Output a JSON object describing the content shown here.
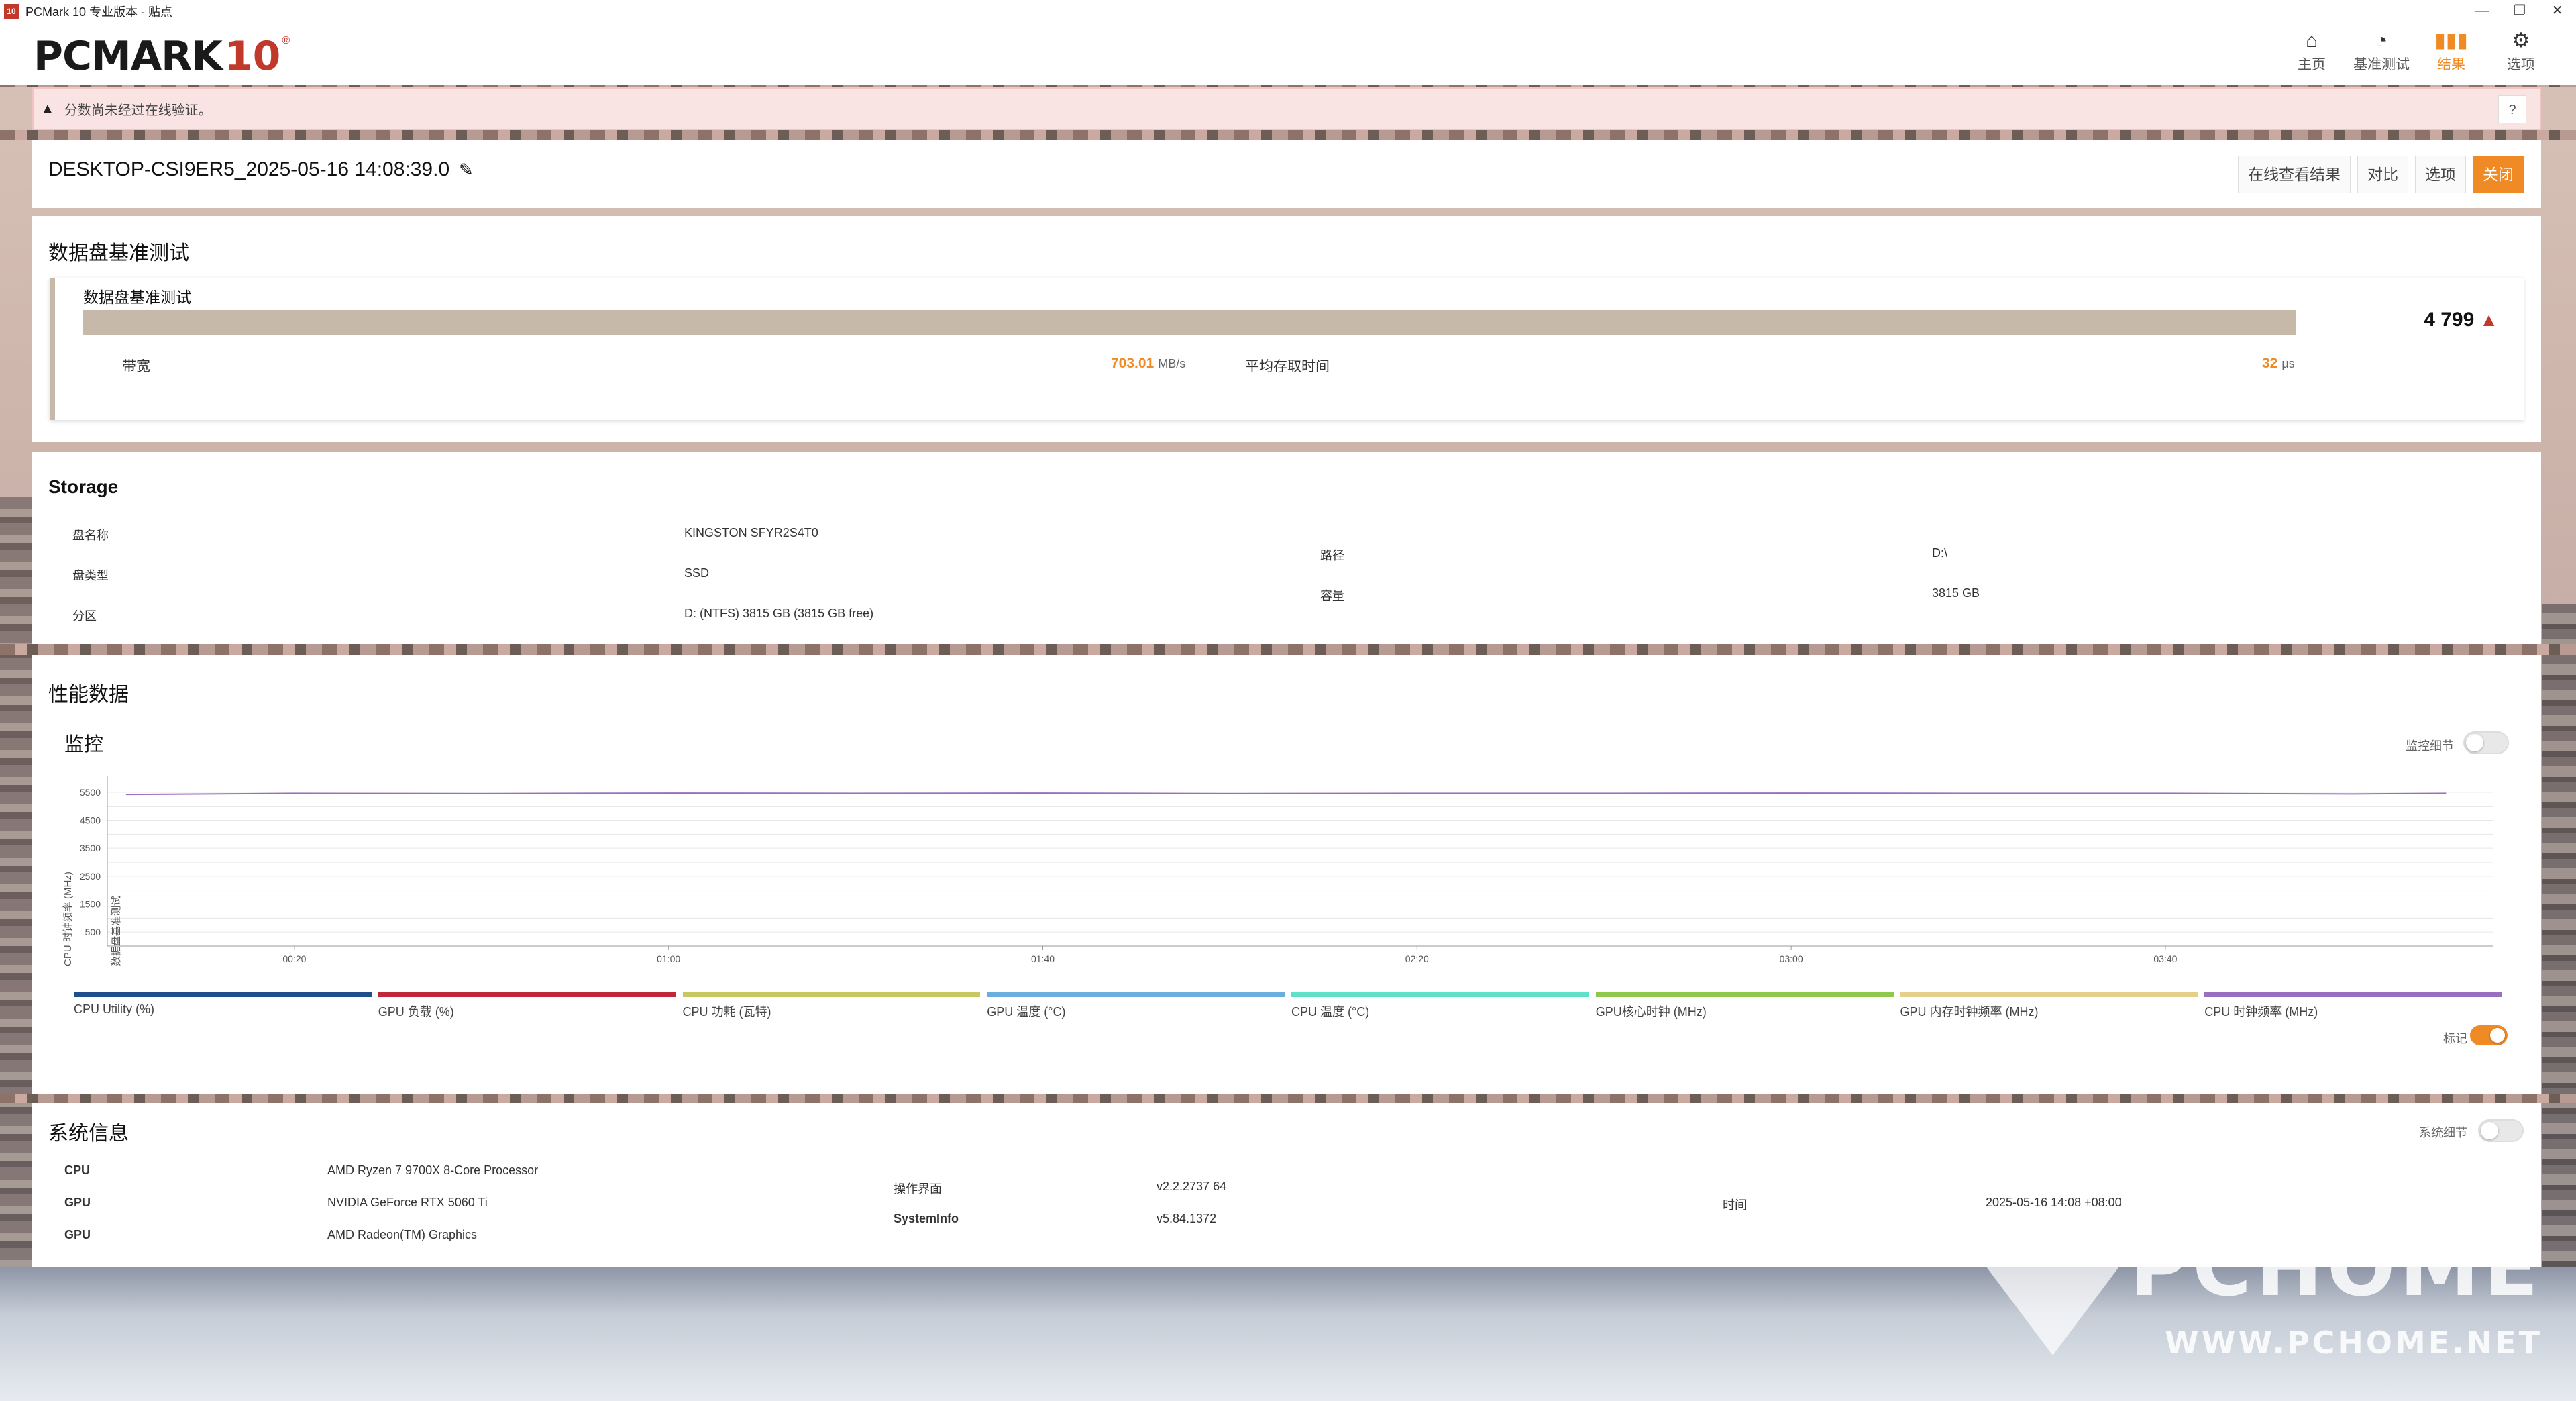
{
  "window": {
    "title": "PCMark 10 专业版本 - 贴点",
    "app_icon": "10"
  },
  "logo": {
    "text": "PCMARK",
    "number": "10"
  },
  "nav": [
    {
      "label": "主页",
      "icon": "home-icon"
    },
    {
      "label": "基准测试",
      "icon": "gauge-icon"
    },
    {
      "label": "结果",
      "icon": "bar-chart-icon",
      "active": true
    },
    {
      "label": "选项",
      "icon": "gear-icon"
    }
  ],
  "warning": {
    "text": "分数尚未经过在线验证。",
    "help": "?"
  },
  "result": {
    "title": "DESKTOP-CSI9ER5_2025-05-16 14:08:39.0",
    "buttons": {
      "view_online": "在线查看结果",
      "compare": "对比",
      "options": "选项",
      "close": "关闭"
    }
  },
  "data_disk": {
    "section_title": "数据盘基准测试",
    "card_title": "数据盘基准测试",
    "score": "4 799",
    "score_fill": 1.0,
    "bandwidth_label": "带宽",
    "bandwidth_value": "703.01",
    "bandwidth_unit": "MB/s",
    "access_label": "平均存取时间",
    "access_value": "32",
    "access_unit": "μs"
  },
  "storage": {
    "title": "Storage",
    "name_label": "盘名称",
    "name_value": "KINGSTON SFYR2S4T0",
    "type_label": "盘类型",
    "type_value": "SSD",
    "partition_label": "分区",
    "partition_value": "D: (NTFS) 3815 GB (3815 GB free)",
    "path_label": "路径",
    "path_value": "D:\\",
    "capacity_label": "容量",
    "capacity_value": "3815 GB"
  },
  "perf": {
    "title": "性能数据",
    "monitor_title": "监控",
    "monitor_detail_label": "监控细节",
    "marker_label": "标记",
    "chart_side_label": "数据盘基准测试"
  },
  "chart_data": {
    "type": "line",
    "ylabel": "CPU 时钟频率 (MHz)",
    "yticks": [
      500,
      1500,
      2500,
      3500,
      4500,
      5500
    ],
    "ylim": [
      0,
      6000
    ],
    "xticks": [
      "00:20",
      "01:00",
      "01:40",
      "02:20",
      "03:00",
      "03:40"
    ],
    "xlim_seconds": [
      0,
      255
    ],
    "series": [
      {
        "name": "CPU 时钟频率 (MHz)",
        "color": "#9b6fc0",
        "x": [
          2,
          20,
          40,
          60,
          80,
          100,
          120,
          140,
          160,
          180,
          200,
          220,
          240,
          250
        ],
        "values": [
          5420,
          5460,
          5450,
          5470,
          5460,
          5470,
          5450,
          5460,
          5460,
          5470,
          5460,
          5460,
          5440,
          5460
        ]
      }
    ],
    "legend": [
      {
        "name": "CPU Utility (%)",
        "color": "#1e4f8c"
      },
      {
        "name": "GPU 负载 (%)",
        "color": "#c0283a"
      },
      {
        "name": "CPU 功耗 (瓦特)",
        "color": "#c8c860"
      },
      {
        "name": "GPU 温度 (°C)",
        "color": "#6aaee0"
      },
      {
        "name": "CPU 温度 (°C)",
        "color": "#5fe0c8"
      },
      {
        "name": "GPU核心时钟 (MHz)",
        "color": "#8fc84a"
      },
      {
        "name": "GPU 内存时钟频率 (MHz)",
        "color": "#e6cf8a"
      },
      {
        "name": "CPU 时钟频率 (MHz)",
        "color": "#9b6fc0"
      }
    ]
  },
  "sysinfo": {
    "title": "系统信息",
    "detail_label": "系统细节",
    "cpu_label": "CPU",
    "cpu_value": "AMD Ryzen 7 9700X 8-Core Processor",
    "gpu1_label": "GPU",
    "gpu1_value": "NVIDIA GeForce RTX 5060 Ti",
    "gpu2_label": "GPU",
    "gpu2_value": "AMD Radeon(TM) Graphics",
    "gui_label": "操作界面",
    "gui_value": "v2.2.2737 64",
    "sysinfo_label": "SystemInfo",
    "sysinfo_value": "v5.84.1372",
    "time_label": "时间",
    "time_value": "2025-05-16 14:08 +08:00"
  },
  "watermark": {
    "big": "PCHOME",
    "small": "WWW.PCHOME.NET"
  },
  "colors": {
    "accent": "#f08a24",
    "score_bar": "#c7b9aa",
    "warning_bg": "#fae3e3"
  }
}
